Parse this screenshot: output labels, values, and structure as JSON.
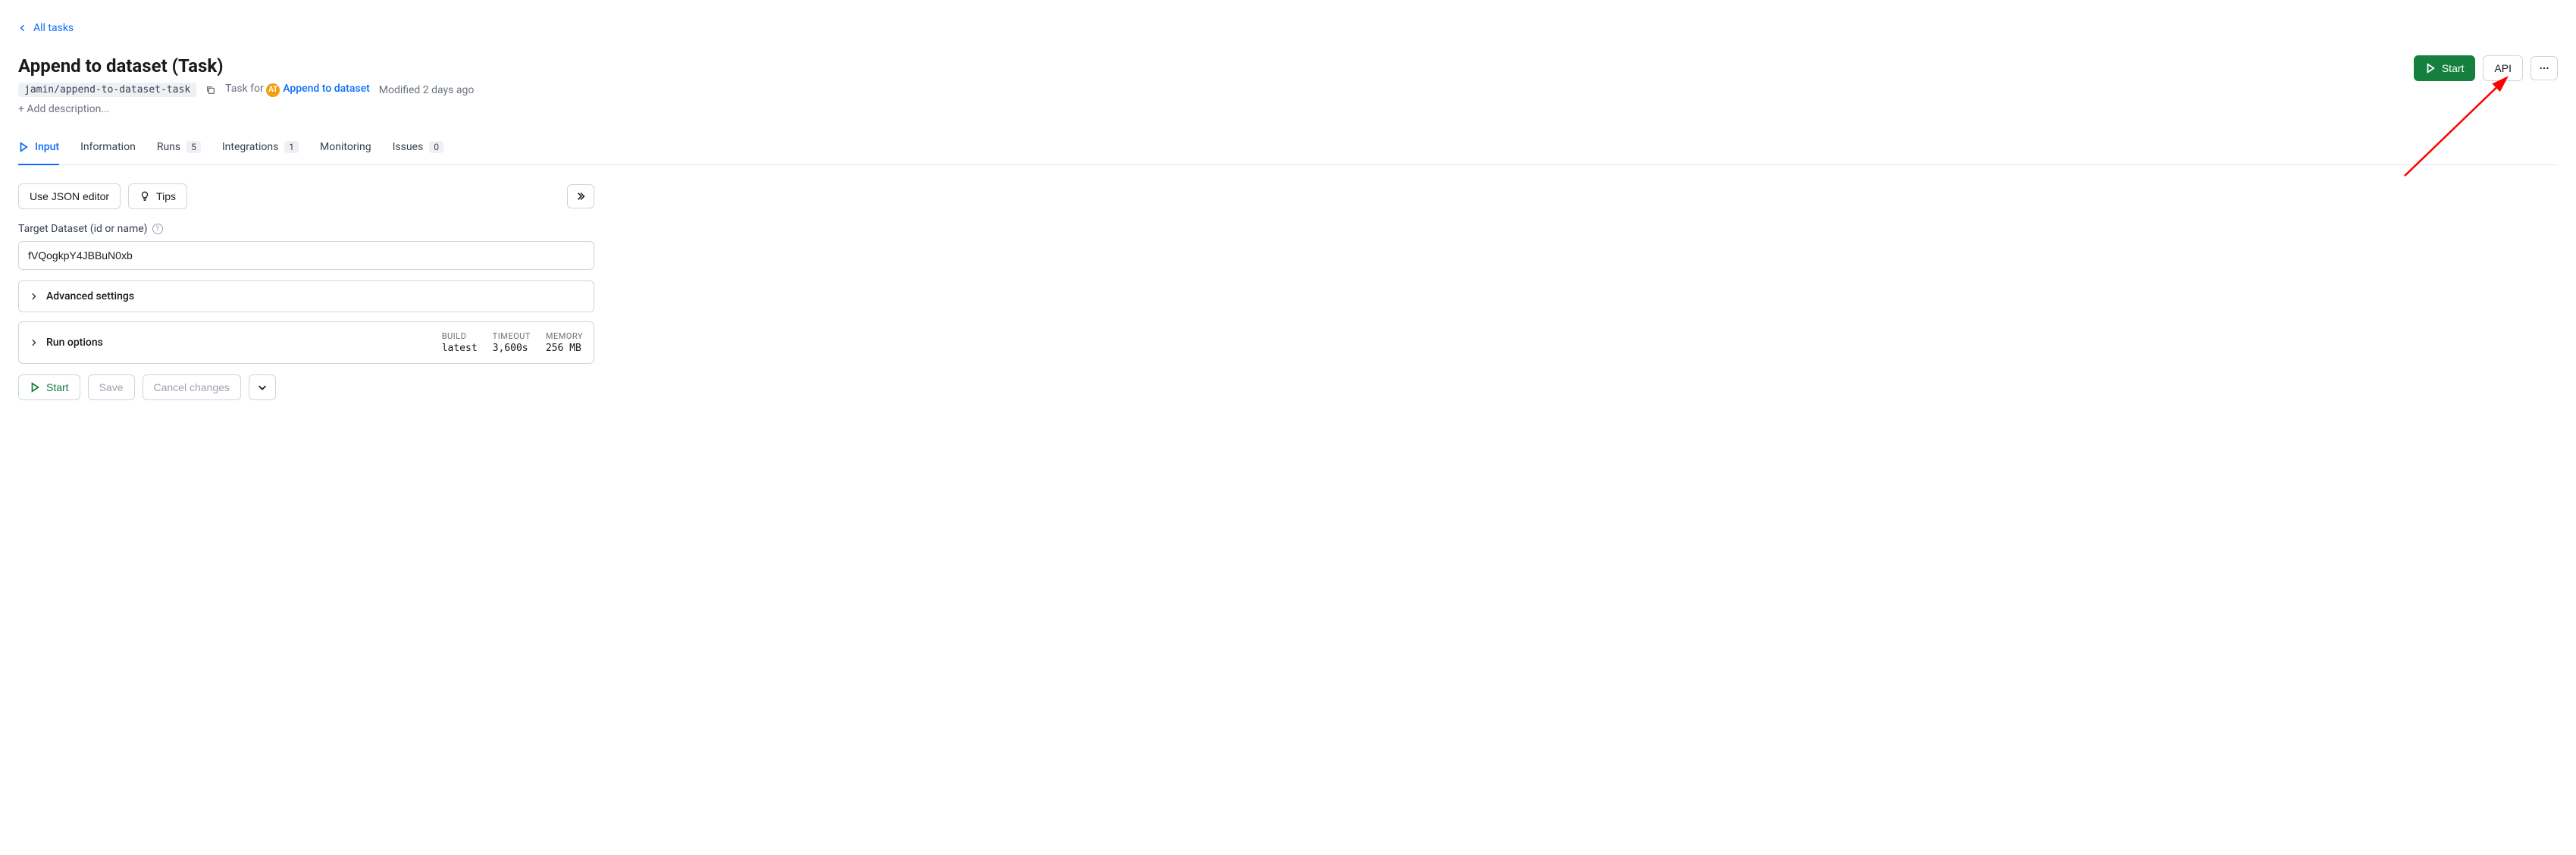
{
  "nav": {
    "back_label": "All tasks"
  },
  "header": {
    "title": "Append to dataset (Task)",
    "slug": "jamin/append-to-dataset-task",
    "task_for_label": "Task for",
    "actor_badge_text": "AT",
    "actor_name": "Append to dataset",
    "modified_text": "Modified 2 days ago",
    "add_description_label": "+ Add description..."
  },
  "header_actions": {
    "start_label": "Start",
    "api_label": "API",
    "more_label": "…"
  },
  "tabs": {
    "input": "Input",
    "information": "Information",
    "runs": "Runs",
    "runs_count": "5",
    "integrations": "Integrations",
    "integrations_count": "1",
    "monitoring": "Monitoring",
    "issues": "Issues",
    "issues_count": "0"
  },
  "toolbar": {
    "json_editor_label": "Use JSON editor",
    "tips_label": "Tips"
  },
  "form": {
    "target_dataset_label": "Target Dataset (id or name)",
    "target_dataset_value": "fVQogkpY4JBBuN0xb"
  },
  "panels": {
    "advanced_label": "Advanced settings",
    "run_options_label": "Run options",
    "stats": {
      "build_label": "BUILD",
      "build_value": "latest",
      "timeout_label": "TIMEOUT",
      "timeout_value": "3,600s",
      "memory_label": "MEMORY",
      "memory_value": "256 MB"
    }
  },
  "bottom": {
    "start_label": "Start",
    "save_label": "Save",
    "cancel_label": "Cancel changes"
  }
}
